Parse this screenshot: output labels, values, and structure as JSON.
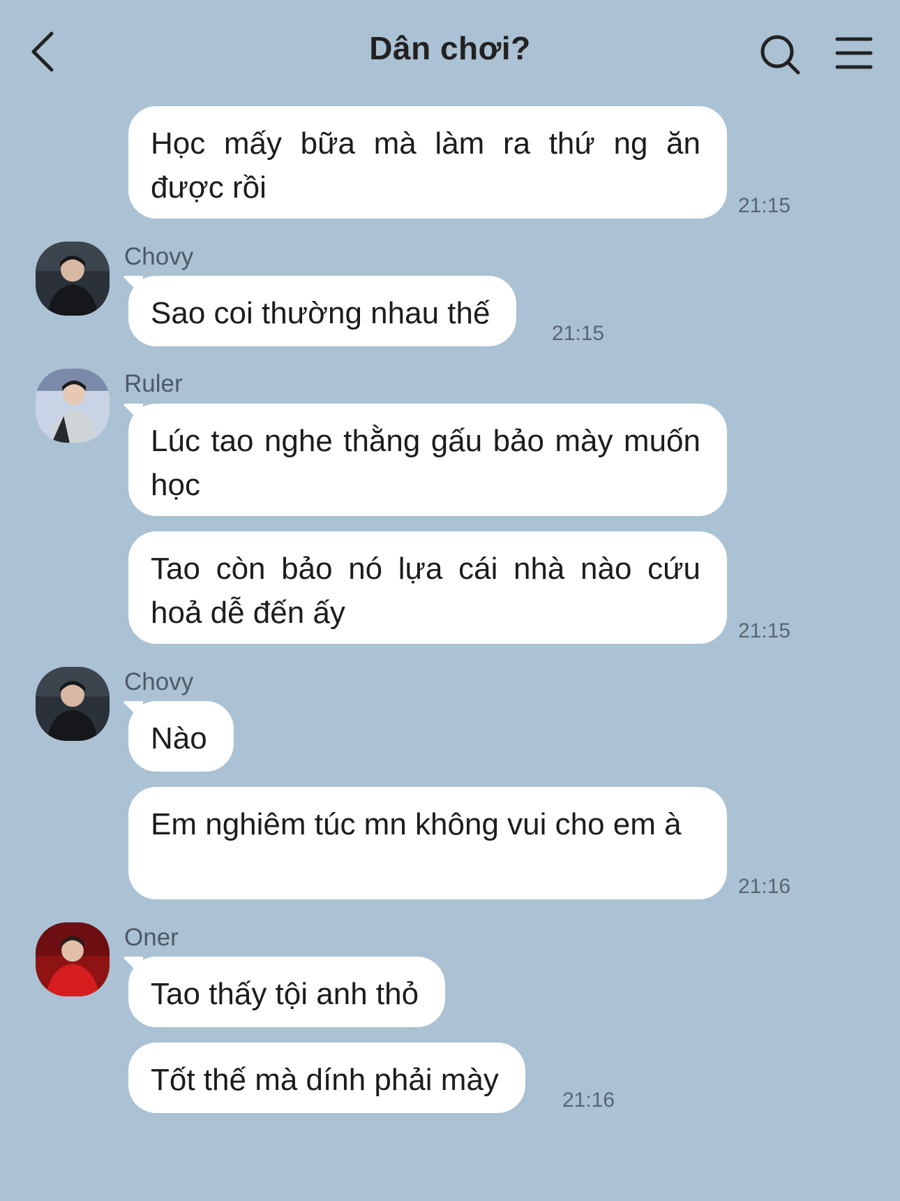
{
  "header": {
    "title": "Dân chơi?",
    "back_icon": "chevron-left-icon",
    "search_icon": "search-icon",
    "menu_icon": "hamburger-menu-icon"
  },
  "colors": {
    "background": "#abc1d4",
    "bubble": "#ffffff"
  },
  "messages": [
    {
      "sender": "",
      "text": "Học mấy bữa mà làm ra thứ ng ăn được rồi",
      "time": "21:15"
    },
    {
      "sender": "Chovy",
      "text": "Sao coi thường nhau thế",
      "time": "21:15"
    },
    {
      "sender": "Ruler",
      "text": "Lúc tao nghe thằng gấu bảo mày muốn học",
      "time": ""
    },
    {
      "sender": "",
      "text": "Tao còn bảo nó lựa cái nhà nào cứu hoả dễ đến ấy",
      "time": "21:15"
    },
    {
      "sender": "Chovy",
      "text": "Nào",
      "time": ""
    },
    {
      "sender": "",
      "text": "Em nghiêm túc mn không vui cho em à",
      "time": "21:16"
    },
    {
      "sender": "Oner",
      "text": "Tao thấy tội anh thỏ",
      "time": ""
    },
    {
      "sender": "",
      "text": "Tốt thế mà dính phải mày",
      "time": "21:16"
    }
  ]
}
